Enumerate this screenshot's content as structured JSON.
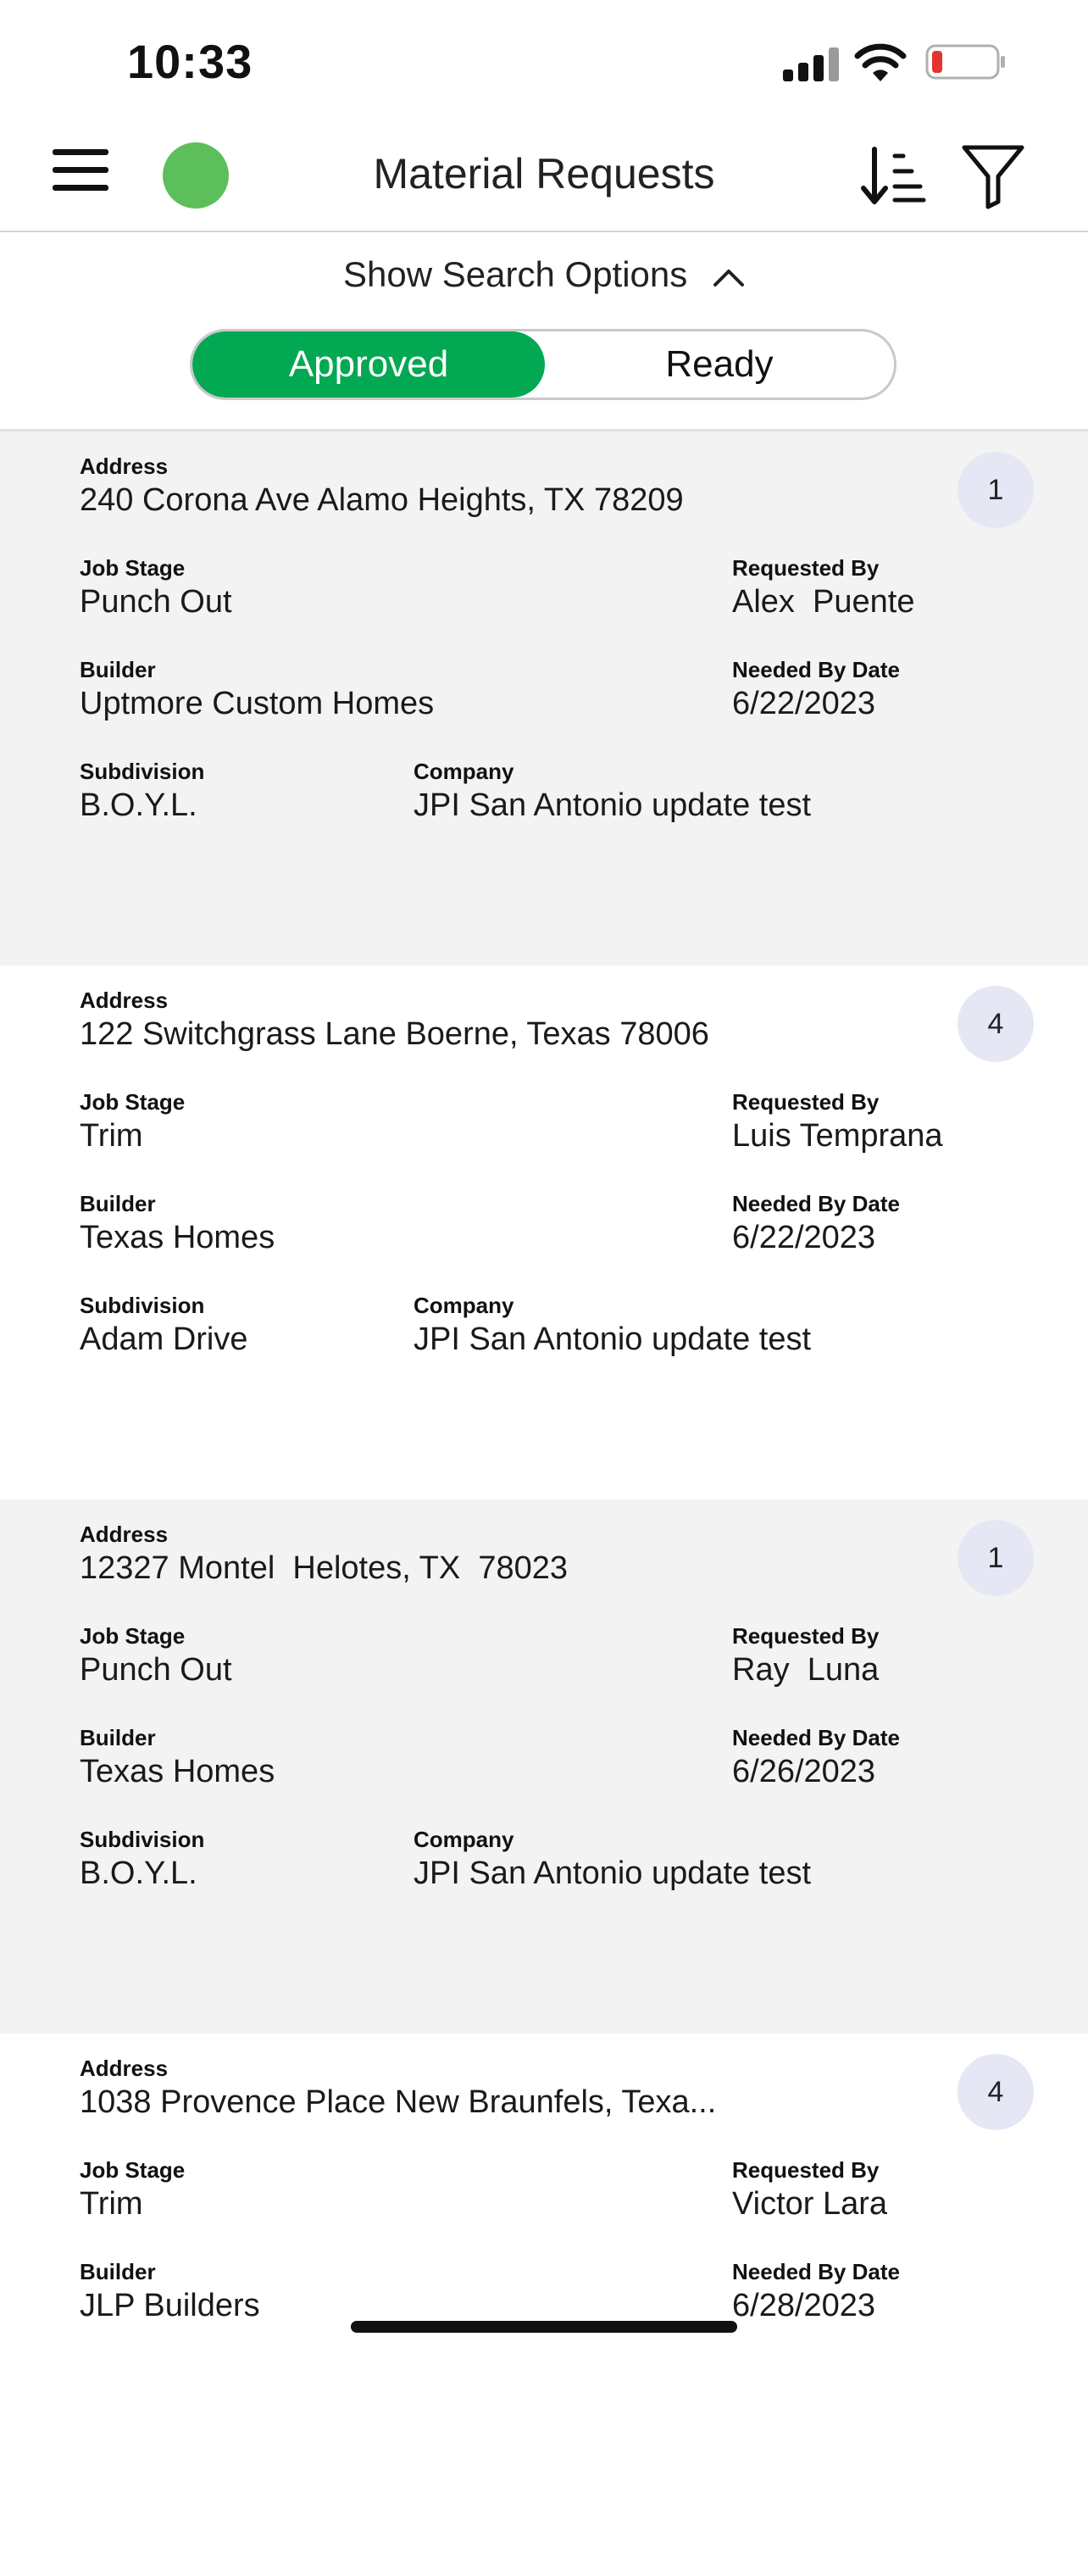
{
  "status_bar": {
    "time": "10:33"
  },
  "header": {
    "title": "Material Requests",
    "status_color": "#5cbf5a"
  },
  "search": {
    "toggle_label": "Show Search Options"
  },
  "segments": {
    "approved": "Approved",
    "ready": "Ready",
    "selected": "Approved",
    "accent": "#02a852"
  },
  "labels": {
    "address": "Address",
    "job_stage": "Job Stage",
    "requested_by": "Requested By",
    "builder": "Builder",
    "needed_by": "Needed By Date",
    "subdivision": "Subdivision",
    "company": "Company"
  },
  "requests": [
    {
      "address": "240 Corona Ave Alamo Heights, TX 78209",
      "count": "1",
      "job_stage": "Punch Out",
      "requested_by": "Alex  Puente",
      "builder": "Uptmore Custom Homes",
      "needed_by": "6/22/2023",
      "subdivision": "B.O.Y.L.",
      "company": "JPI San Antonio update test"
    },
    {
      "address": "122 Switchgrass Lane Boerne, Texas 78006",
      "count": "4",
      "job_stage": "Trim",
      "requested_by": "Luis Temprana",
      "builder": "Texas Homes",
      "needed_by": "6/22/2023",
      "subdivision": "Adam Drive",
      "company": "JPI San Antonio update test"
    },
    {
      "address": "12327 Montel  Helotes, TX  78023",
      "count": "1",
      "job_stage": "Punch Out",
      "requested_by": "Ray  Luna",
      "builder": "Texas Homes",
      "needed_by": "6/26/2023",
      "subdivision": "B.O.Y.L.",
      "company": "JPI San Antonio update test"
    },
    {
      "address": "1038 Provence Place New Braunfels, Texa...",
      "count": "4",
      "job_stage": "Trim",
      "requested_by": "Victor Lara",
      "builder": "JLP Builders",
      "needed_by": "6/28/2023"
    }
  ]
}
